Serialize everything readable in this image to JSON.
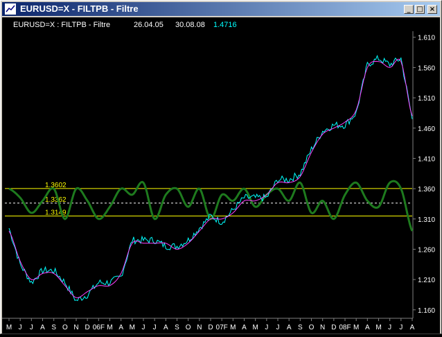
{
  "window": {
    "title": "EURUSD=X  - FILTPB - Filtre",
    "buttons": {
      "minimize": "_",
      "maximize": "□",
      "close": "×"
    }
  },
  "chart_header": {
    "label": "EURUSD=X : FILTPB - Filtre",
    "start_date": "26.04.05",
    "end_date": "30.08.08",
    "last_value": "1.4716"
  },
  "colors": {
    "background": "#000000",
    "price": "#00ffff",
    "filter": "#ff40ff",
    "oscillator": "#1e7a1e",
    "bands": "#ffff00",
    "axis_text": "#ffffff",
    "header_text": "#ffffff",
    "last_value": "#00ffff"
  },
  "chart_data": {
    "type": "line",
    "ylim": [
      1.16,
      1.62
    ],
    "y_ticks": [
      "1.610",
      "1.560",
      "1.510",
      "1.460",
      "1.410",
      "1.360",
      "1.310",
      "1.260",
      "1.210",
      "1.160"
    ],
    "x_ticks": [
      "M",
      "J",
      "J",
      "A",
      "S",
      "O",
      "N",
      "D",
      "06F",
      "M",
      "A",
      "M",
      "J",
      "J",
      "A",
      "S",
      "O",
      "N",
      "D",
      "07F",
      "M",
      "A",
      "M",
      "J",
      "J",
      "A",
      "S",
      "O",
      "N",
      "D",
      "08F",
      "M",
      "A",
      "M",
      "J",
      "J",
      "A"
    ],
    "levels": [
      {
        "label": "1.3602",
        "value": 1.3602,
        "style": "solid"
      },
      {
        "label": "1.3362",
        "value": 1.3362,
        "style": "dashed"
      },
      {
        "label": "1.3149",
        "value": 1.3149,
        "style": "solid"
      }
    ],
    "series": [
      {
        "values_monthly": [
          1.295,
          1.235,
          1.205,
          1.225,
          1.225,
          1.205,
          1.175,
          1.185,
          1.205,
          1.205,
          1.215,
          1.275,
          1.275,
          1.275,
          1.265,
          1.265,
          1.275,
          1.295,
          1.315,
          1.305,
          1.325,
          1.345,
          1.345,
          1.345,
          1.375,
          1.375,
          1.385,
          1.425,
          1.455,
          1.465,
          1.465,
          1.485,
          1.565,
          1.575,
          1.565,
          1.575,
          1.475
        ]
      },
      {
        "values_monthly": [
          1.29,
          1.24,
          1.21,
          1.22,
          1.22,
          1.2,
          1.18,
          1.19,
          1.2,
          1.2,
          1.22,
          1.27,
          1.27,
          1.27,
          1.27,
          1.26,
          1.27,
          1.29,
          1.31,
          1.31,
          1.32,
          1.34,
          1.34,
          1.35,
          1.37,
          1.37,
          1.38,
          1.42,
          1.45,
          1.46,
          1.47,
          1.49,
          1.56,
          1.57,
          1.56,
          1.57,
          1.48
        ]
      },
      {
        "values_monthly": [
          1.36,
          1.345,
          1.32,
          1.34,
          1.36,
          1.31,
          1.36,
          1.34,
          1.31,
          1.33,
          1.36,
          1.35,
          1.37,
          1.31,
          1.35,
          1.36,
          1.33,
          1.36,
          1.31,
          1.35,
          1.34,
          1.36,
          1.33,
          1.35,
          1.36,
          1.34,
          1.37,
          1.32,
          1.34,
          1.31,
          1.35,
          1.37,
          1.34,
          1.33,
          1.37,
          1.36,
          1.29
        ]
      }
    ]
  }
}
